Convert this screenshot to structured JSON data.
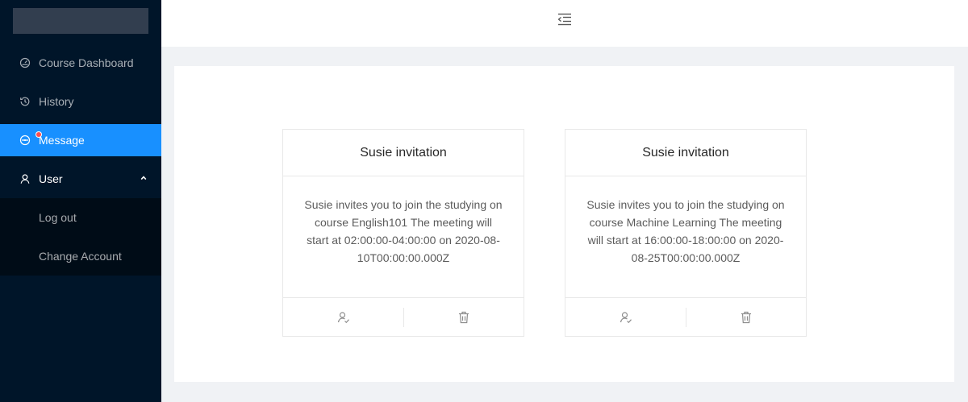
{
  "sidebar": {
    "items": [
      {
        "label": "Course Dashboard",
        "icon": "dashboard-icon"
      },
      {
        "label": "History",
        "icon": "history-icon"
      },
      {
        "label": "Message",
        "icon": "message-icon",
        "active": true,
        "badge": "dot"
      }
    ],
    "user_menu": {
      "label": "User",
      "icon": "user-icon",
      "expanded": true,
      "items": [
        {
          "label": "Log out"
        },
        {
          "label": "Change Account"
        }
      ]
    }
  },
  "header": {
    "menu_fold_icon": "menu-fold-icon"
  },
  "cards": [
    {
      "title": "Susie invitation",
      "body": "Susie invites you to join the studying on course English101 The meeting will start at 02:00:00-04:00:00 on 2020-08-10T00:00:00.000Z",
      "actions": [
        "accept-icon",
        "delete-icon"
      ]
    },
    {
      "title": "Susie invitation",
      "body": "Susie invites you to join the studying on course Machine Learning The meeting will start at 16:00:00-18:00:00 on 2020-08-25T00:00:00.000Z",
      "actions": [
        "accept-icon",
        "delete-icon"
      ]
    }
  ],
  "colors": {
    "sider_bg": "#001529",
    "active_bg": "#1890ff",
    "badge": "#ff4d4f"
  }
}
